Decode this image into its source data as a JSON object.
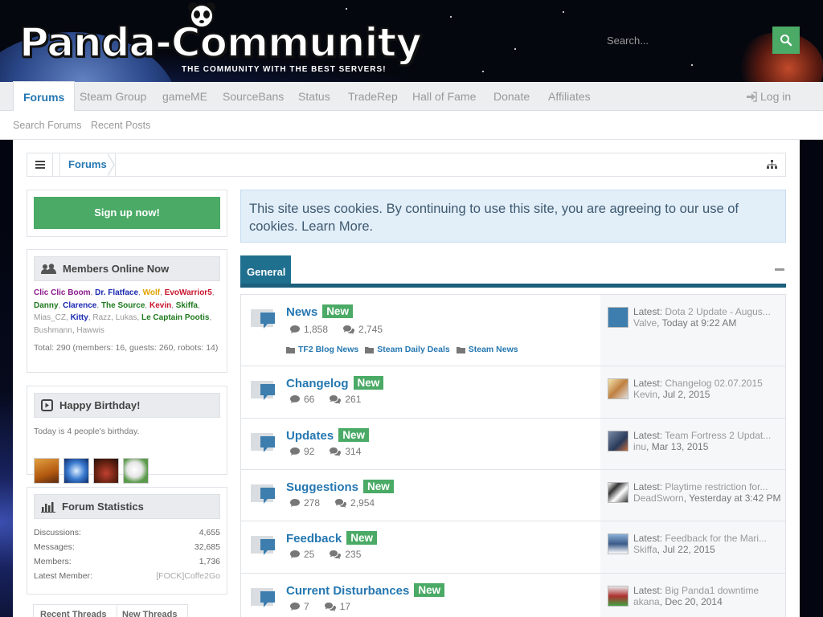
{
  "site": {
    "logo_text": "Panda-Community",
    "tagline": "THE COMMUNITY WITH THE BEST SERVERS!"
  },
  "search": {
    "placeholder": "Search..."
  },
  "nav": {
    "tabs": [
      "Forums",
      "Steam Group",
      "gameME",
      "SourceBans",
      "Status",
      "TradeRep",
      "Hall of Fame",
      "Donate",
      "Affiliates"
    ],
    "login": "Log in"
  },
  "subnav": [
    "Search Forums",
    "Recent Posts"
  ],
  "breadcrumb": {
    "current": "Forums"
  },
  "sidebar": {
    "signup": "Sign up now!",
    "members_online": {
      "title": "Members Online Now",
      "members": [
        {
          "name": "Clic Clic Boom",
          "color": "#8b1a8b"
        },
        {
          "name": "Dr. Flatface",
          "color": "#1a2ab0"
        },
        {
          "name": "Wolf",
          "color": "#e0a000"
        },
        {
          "name": "EvoWarrior5",
          "color": "#c8142c"
        },
        {
          "name": "Danny",
          "color": "#1f7a1f"
        },
        {
          "name": "Clarence",
          "color": "#1a2ab0"
        },
        {
          "name": "The Source",
          "color": "#1f7a1f"
        },
        {
          "name": "Kevin",
          "color": "#c8142c"
        },
        {
          "name": "Skiffa",
          "color": "#1f7a1f"
        },
        {
          "name": "Mias_CZ",
          "color": "#999999"
        },
        {
          "name": "Kitty",
          "color": "#1a2ab0"
        },
        {
          "name": "Razz",
          "color": "#999999"
        },
        {
          "name": "Lukas",
          "color": "#999999"
        },
        {
          "name": "Le Captain Pootis",
          "color": "#1f7a1f"
        },
        {
          "name": "Bushmann",
          "color": "#999999"
        },
        {
          "name": "Hawwis",
          "color": "#999999"
        }
      ],
      "total": "Total: 290 (members: 16, guests: 260, robots: 14)"
    },
    "birthday": {
      "title": "Happy Birthday!",
      "text": "Today is 4 people's birthday."
    },
    "stats": {
      "title": "Forum Statistics",
      "rows": [
        {
          "label": "Discussions:",
          "value": "4,655"
        },
        {
          "label": "Messages:",
          "value": "32,685"
        },
        {
          "label": "Members:",
          "value": "1,736"
        },
        {
          "label": "Latest Member:",
          "value": "[FOCK]Coffe2Go"
        }
      ]
    },
    "thread_tabs": [
      "Recent Threads",
      "New Threads"
    ]
  },
  "notice": {
    "text": "This site uses cookies. By continuing to use this site, you are agreeing to our use of cookies.",
    "link": "Learn More."
  },
  "category": {
    "title": "General"
  },
  "forums": [
    {
      "title": "News",
      "badge": "New",
      "discussions": "1,858",
      "messages": "2,745",
      "subforums": [
        "TF2 Blog News",
        "Steam Daily Deals",
        "Steam News"
      ],
      "latest": {
        "label": "Latest:",
        "title": "Dota 2 Update - Augus...",
        "user": "Valve",
        "time": "Today at 9:22 AM"
      }
    },
    {
      "title": "Changelog",
      "badge": "New",
      "discussions": "66",
      "messages": "261",
      "latest": {
        "label": "Latest:",
        "title": "Changelog 02.07.2015",
        "user": "Kevin",
        "time": "Jul 2, 2015"
      }
    },
    {
      "title": "Updates",
      "badge": "New",
      "discussions": "92",
      "messages": "314",
      "latest": {
        "label": "Latest:",
        "title": "Team Fortress 2 Updat...",
        "user": "inu",
        "time": "Mar 13, 2015"
      }
    },
    {
      "title": "Suggestions",
      "badge": "New",
      "discussions": "278",
      "messages": "2,954",
      "latest": {
        "label": "Latest:",
        "title": "Playtime restriction for...",
        "user": "DeadSworn",
        "time": "Yesterday at 3:42 PM"
      }
    },
    {
      "title": "Feedback",
      "badge": "New",
      "discussions": "25",
      "messages": "235",
      "latest": {
        "label": "Latest:",
        "title": "Feedback for the Mari...",
        "user": "Skiffa",
        "time": "Jul 22, 2015"
      }
    },
    {
      "title": "Current Disturbances",
      "badge": "New",
      "discussions": "7",
      "messages": "17",
      "latest": {
        "label": "Latest:",
        "title": "Big Panda1 downtime",
        "user": "akana",
        "time": "Dec 20, 2014"
      }
    }
  ],
  "colors": {
    "accent": "#2577b1",
    "green": "#4aaa66",
    "category": "#1f6f8f"
  }
}
